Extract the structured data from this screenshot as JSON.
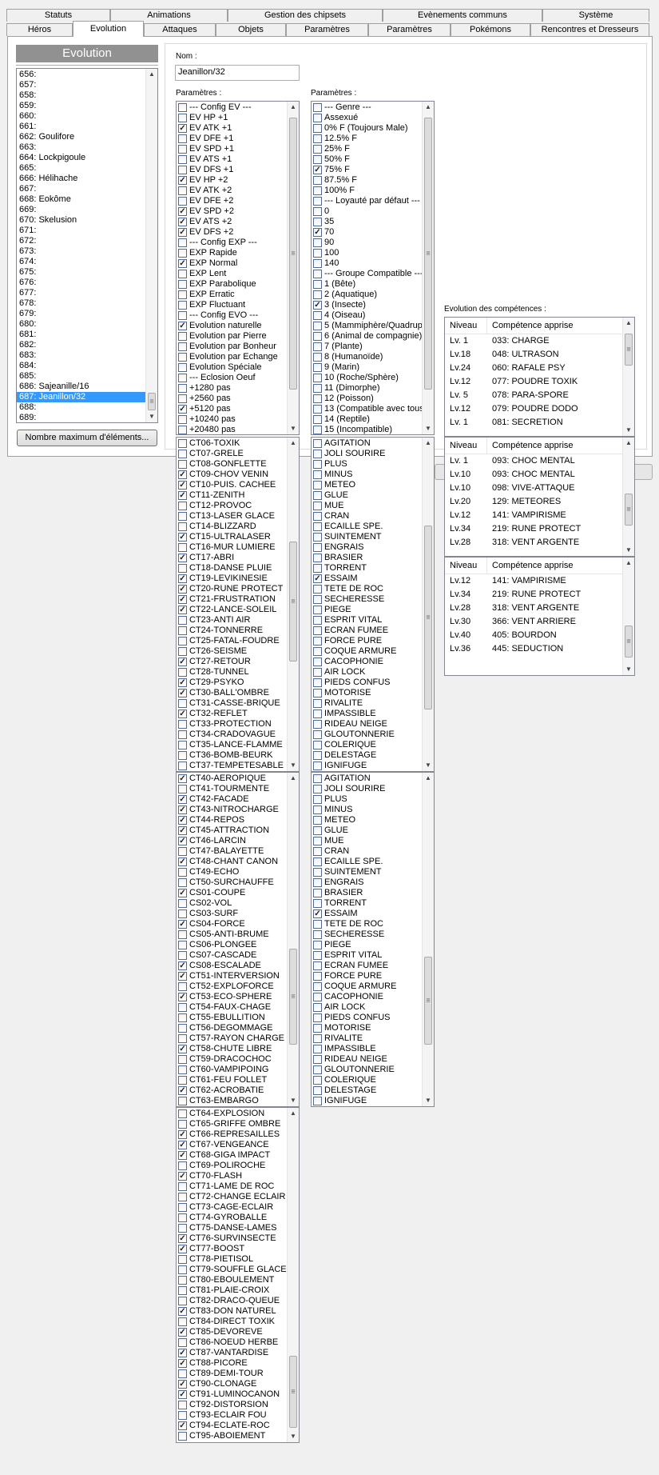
{
  "tabs_row1": [
    "Statuts",
    "Animations",
    "Gestion des chipsets",
    "Evènements communs",
    "Système"
  ],
  "tabs_row2": [
    "Héros",
    "Evolution",
    "Attaques",
    "Objets",
    "Paramètres",
    "Paramètres",
    "Pokémons",
    "Rencontres et Dresseurs"
  ],
  "active_tab": "Evolution",
  "evolution": {
    "title": "Evolution",
    "selected_index": 15,
    "items": [
      "656:",
      "657:",
      "658:",
      "659:",
      "660:",
      "661:",
      "662: Goulifore",
      "663:",
      "664: Lockpigoule",
      "665:",
      "666: Hélihache",
      "667:",
      "668: Eokôme",
      "669:",
      "670: Skelusion",
      "671:",
      "672:",
      "673:",
      "674:",
      "675:",
      "676:",
      "677:",
      "678:",
      "679:",
      "680:",
      "681:",
      "682:",
      "683:",
      "684:",
      "685:",
      "686: Sajeanille/16",
      "687: Jeanillon/32",
      "688:",
      "689:"
    ],
    "max_button": "Nombre maximum d'éléments..."
  },
  "nom": {
    "label": "Nom :",
    "value": "Jeanillon/32"
  },
  "params1": {
    "label": "Paramètres :",
    "items": [
      [
        "--- Config EV ---",
        0
      ],
      [
        "EV HP +1",
        0
      ],
      [
        "EV ATK +1",
        1
      ],
      [
        "EV DFE +1",
        0
      ],
      [
        "EV SPD +1",
        0
      ],
      [
        "EV ATS +1",
        0
      ],
      [
        "EV DFS +1",
        0
      ],
      [
        "EV HP +2",
        1
      ],
      [
        "EV ATK +2",
        0
      ],
      [
        "EV DFE +2",
        0
      ],
      [
        "EV SPD +2",
        1
      ],
      [
        "EV ATS +2",
        1
      ],
      [
        "EV DFS +2",
        1
      ],
      [
        "--- Config EXP ---",
        0
      ],
      [
        "EXP Rapide",
        0
      ],
      [
        "EXP Normal",
        1
      ],
      [
        "EXP Lent",
        0
      ],
      [
        "EXP Parabolique",
        0
      ],
      [
        "EXP Erratic",
        0
      ],
      [
        "EXP Fluctuant",
        0
      ],
      [
        "--- Config EVO ---",
        0
      ],
      [
        "Evolution naturelle",
        1
      ],
      [
        "Evolution par Pierre",
        0
      ],
      [
        "Evolution par Bonheur",
        0
      ],
      [
        "Evolution par Echange",
        0
      ],
      [
        "Evolution Spéciale",
        0
      ],
      [
        "--- Eclosion Oeuf",
        0
      ],
      [
        "+1280 pas",
        0
      ],
      [
        "+2560 pas",
        0
      ],
      [
        "+5120 pas",
        1
      ],
      [
        "+10240 pas",
        0
      ],
      [
        "+20480 pas",
        0
      ]
    ]
  },
  "params2": {
    "label": "Paramètres :",
    "items": [
      [
        "--- Genre ---",
        0
      ],
      [
        "Assexué",
        0
      ],
      [
        "0% F (Toujours Male)",
        0
      ],
      [
        "12.5% F",
        0
      ],
      [
        "25% F",
        0
      ],
      [
        "50% F",
        0
      ],
      [
        "75% F",
        1
      ],
      [
        "87.5% F",
        0
      ],
      [
        "100% F",
        0
      ],
      [
        "--- Loyauté par défaut ---",
        0
      ],
      [
        "0",
        0
      ],
      [
        "35",
        0
      ],
      [
        "70",
        1
      ],
      [
        "90",
        0
      ],
      [
        "100",
        0
      ],
      [
        "140",
        0
      ],
      [
        "--- Groupe Compatible ---",
        0
      ],
      [
        "1 (Bête)",
        0
      ],
      [
        "2 (Aquatique)",
        0
      ],
      [
        "3 (Insecte)",
        1
      ],
      [
        "4 (Oiseau)",
        0
      ],
      [
        "5 (Mammiphère/Quadrup",
        0
      ],
      [
        "6 (Animal de compagnie)",
        0
      ],
      [
        "7 (Plante)",
        0
      ],
      [
        "8 (Humanoïde)",
        0
      ],
      [
        "9 (Marin)",
        0
      ],
      [
        "10 (Roche/Sphère)",
        0
      ],
      [
        "11 (Dimorphe)",
        0
      ],
      [
        "12 (Poisson)",
        0
      ],
      [
        "13 (Compatible avec tous",
        0
      ],
      [
        "14 (Reptile)",
        0
      ],
      [
        "15 (Incompatible)",
        0
      ]
    ]
  },
  "ct1": [
    [
      "CT06-TOXIK",
      0
    ],
    [
      "CT07-GRELE",
      0
    ],
    [
      "CT08-GONFLETTE",
      0
    ],
    [
      "CT09-CHOV VENIN",
      1
    ],
    [
      "CT10-PUIS. CACHEE",
      1
    ],
    [
      "CT11-ZENITH",
      1
    ],
    [
      "CT12-PROVOC",
      0
    ],
    [
      "CT13-LASER GLACE",
      0
    ],
    [
      "CT14-BLIZZARD",
      0
    ],
    [
      "CT15-ULTRALASER",
      1
    ],
    [
      "CT16-MUR LUMIERE",
      0
    ],
    [
      "CT17-ABRI",
      1
    ],
    [
      "CT18-DANSE PLUIE",
      0
    ],
    [
      "CT19-LEVIKINESIE",
      1
    ],
    [
      "CT20-RUNE PROTECT",
      1
    ],
    [
      "CT21-FRUSTRATION",
      1
    ],
    [
      "CT22-LANCE-SOLEIL",
      1
    ],
    [
      "CT23-ANTI AIR",
      0
    ],
    [
      "CT24-TONNERRE",
      0
    ],
    [
      "CT25-FATAL-FOUDRE",
      0
    ],
    [
      "CT26-SEISME",
      0
    ],
    [
      "CT27-RETOUR",
      1
    ],
    [
      "CT28-TUNNEL",
      0
    ],
    [
      "CT29-PSYKO",
      1
    ],
    [
      "CT30-BALL'OMBRE",
      1
    ],
    [
      "CT31-CASSE-BRIQUE",
      0
    ],
    [
      "CT32-REFLET",
      1
    ],
    [
      "CT33-PROTECTION",
      0
    ],
    [
      "CT34-CRADOVAGUE",
      0
    ],
    [
      "CT35-LANCE-FLAMME",
      0
    ],
    [
      "CT36-BOMB-BEURK",
      0
    ],
    [
      "CT37-TEMPETESABLE",
      0
    ]
  ],
  "ab1": [
    [
      "AGITATION",
      0
    ],
    [
      "JOLI SOURIRE",
      0
    ],
    [
      "PLUS",
      0
    ],
    [
      "MINUS",
      0
    ],
    [
      "METEO",
      0
    ],
    [
      "GLUE",
      0
    ],
    [
      "MUE",
      0
    ],
    [
      "CRAN",
      0
    ],
    [
      "ECAILLE SPE.",
      0
    ],
    [
      "SUINTEMENT",
      0
    ],
    [
      "ENGRAIS",
      0
    ],
    [
      "BRASIER",
      0
    ],
    [
      "TORRENT",
      0
    ],
    [
      "ESSAIM",
      1
    ],
    [
      "TETE DE ROC",
      0
    ],
    [
      "SECHERESSE",
      0
    ],
    [
      "PIEGE",
      0
    ],
    [
      "ESPRIT VITAL",
      0
    ],
    [
      "ECRAN FUMEE",
      0
    ],
    [
      "FORCE PURE",
      0
    ],
    [
      "COQUE ARMURE",
      0
    ],
    [
      "CACOPHONIE",
      0
    ],
    [
      "AIR LOCK",
      0
    ],
    [
      "PIEDS CONFUS",
      0
    ],
    [
      "MOTORISE",
      0
    ],
    [
      "RIVALITE",
      0
    ],
    [
      "IMPASSIBLE",
      0
    ],
    [
      "RIDEAU NEIGE",
      0
    ],
    [
      "GLOUTONNERIE",
      0
    ],
    [
      "COLERIQUE",
      0
    ],
    [
      "DELESTAGE",
      0
    ],
    [
      "IGNIFUGE",
      0
    ]
  ],
  "ct2": [
    [
      "CT40-AEROPIQUE",
      1
    ],
    [
      "CT41-TOURMENTE",
      0
    ],
    [
      "CT42-FACADE",
      1
    ],
    [
      "CT43-NITROCHARGE",
      1
    ],
    [
      "CT44-REPOS",
      1
    ],
    [
      "CT45-ATTRACTION",
      1
    ],
    [
      "CT46-LARCIN",
      1
    ],
    [
      "CT47-BALAYETTE",
      0
    ],
    [
      "CT48-CHANT CANON",
      1
    ],
    [
      "CT49-ECHO",
      0
    ],
    [
      "CT50-SURCHAUFFE",
      0
    ],
    [
      "CS01-COUPE",
      1
    ],
    [
      "CS02-VOL",
      0
    ],
    [
      "CS03-SURF",
      0
    ],
    [
      "CS04-FORCE",
      1
    ],
    [
      "CS05-ANTI-BRUME",
      0
    ],
    [
      "CS06-PLONGEE",
      0
    ],
    [
      "CS07-CASCADE",
      0
    ],
    [
      "CS08-ESCALADE",
      1
    ],
    [
      "CT51-INTERVERSION",
      1
    ],
    [
      "CT52-EXPLOFORCE",
      0
    ],
    [
      "CT53-ECO-SPHERE",
      1
    ],
    [
      "CT54-FAUX-CHAGE",
      0
    ],
    [
      "CT55-EBULLITION",
      0
    ],
    [
      "CT56-DEGOMMAGE",
      0
    ],
    [
      "CT57-RAYON CHARGE",
      0
    ],
    [
      "CT58-CHUTE LIBRE",
      1
    ],
    [
      "CT59-DRACOCHOC",
      0
    ],
    [
      "CT60-VAMPIPOING",
      0
    ],
    [
      "CT61-FEU FOLLET",
      0
    ],
    [
      "CT62-ACROBATIE",
      1
    ],
    [
      "CT63-EMBARGO",
      0
    ]
  ],
  "ab2": [
    [
      "AGITATION",
      0
    ],
    [
      "JOLI SOURIRE",
      0
    ],
    [
      "PLUS",
      0
    ],
    [
      "MINUS",
      0
    ],
    [
      "METEO",
      0
    ],
    [
      "GLUE",
      0
    ],
    [
      "MUE",
      0
    ],
    [
      "CRAN",
      0
    ],
    [
      "ECAILLE SPE.",
      0
    ],
    [
      "SUINTEMENT",
      0
    ],
    [
      "ENGRAIS",
      0
    ],
    [
      "BRASIER",
      0
    ],
    [
      "TORRENT",
      0
    ],
    [
      "ESSAIM",
      1
    ],
    [
      "TETE DE ROC",
      0
    ],
    [
      "SECHERESSE",
      0
    ],
    [
      "PIEGE",
      0
    ],
    [
      "ESPRIT VITAL",
      0
    ],
    [
      "ECRAN FUMEE",
      0
    ],
    [
      "FORCE PURE",
      0
    ],
    [
      "COQUE ARMURE",
      0
    ],
    [
      "CACOPHONIE",
      0
    ],
    [
      "AIR LOCK",
      0
    ],
    [
      "PIEDS CONFUS",
      0
    ],
    [
      "MOTORISE",
      0
    ],
    [
      "RIVALITE",
      0
    ],
    [
      "IMPASSIBLE",
      0
    ],
    [
      "RIDEAU NEIGE",
      0
    ],
    [
      "GLOUTONNERIE",
      0
    ],
    [
      "COLERIQUE",
      0
    ],
    [
      "DELESTAGE",
      0
    ],
    [
      "IGNIFUGE",
      0
    ]
  ],
  "ct3": [
    [
      "CT64-EXPLOSION",
      0
    ],
    [
      "CT65-GRIFFE OMBRE",
      0
    ],
    [
      "CT66-REPRESAILLES",
      1
    ],
    [
      "CT67-VENGEANCE",
      1
    ],
    [
      "CT68-GIGA IMPACT",
      1
    ],
    [
      "CT69-POLIROCHE",
      0
    ],
    [
      "CT70-FLASH",
      1
    ],
    [
      "CT71-LAME DE ROC",
      0
    ],
    [
      "CT72-CHANGE ECLAIR",
      0
    ],
    [
      "CT73-CAGE-ECLAIR",
      0
    ],
    [
      "CT74-GYROBALLE",
      0
    ],
    [
      "CT75-DANSE-LAMES",
      0
    ],
    [
      "CT76-SURVINSECTE",
      1
    ],
    [
      "CT77-BOOST",
      1
    ],
    [
      "CT78-PIETISOL",
      0
    ],
    [
      "CT79-SOUFFLE GLACE",
      0
    ],
    [
      "CT80-EBOULEMENT",
      0
    ],
    [
      "CT81-PLAIE-CROIX",
      0
    ],
    [
      "CT82-DRACO-QUEUE",
      0
    ],
    [
      "CT83-DON NATUREL",
      1
    ],
    [
      "CT84-DIRECT TOXIK",
      0
    ],
    [
      "CT85-DEVOREVE",
      1
    ],
    [
      "CT86-NOEUD HERBE",
      0
    ],
    [
      "CT87-VANTARDISE",
      1
    ],
    [
      "CT88-PICORE",
      1
    ],
    [
      "CT89-DEMI-TOUR",
      0
    ],
    [
      "CT90-CLONAGE",
      1
    ],
    [
      "CT91-LUMINOCANON",
      1
    ],
    [
      "CT92-DISTORSION",
      0
    ],
    [
      "CT93-ECLAIR FOU",
      0
    ],
    [
      "CT94-ECLATE-ROC",
      1
    ],
    [
      "CT95-ABOIEMENT",
      0
    ]
  ],
  "evo_comp": {
    "label": "Evolution des compétences :",
    "col_level": "Niveau",
    "col_skill": "Compétence apprise",
    "table1": [
      [
        "Lv. 1",
        "033: CHARGE"
      ],
      [
        "Lv.18",
        "048: ULTRASON"
      ],
      [
        "Lv.24",
        "060: RAFALE PSY"
      ],
      [
        "Lv.12",
        "077: POUDRE TOXIK"
      ],
      [
        "Lv. 5",
        "078: PARA-SPORE"
      ],
      [
        "Lv.12",
        "079: POUDRE DODO"
      ],
      [
        "Lv. 1",
        "081: SECRETION"
      ]
    ],
    "table2": [
      [
        "Lv. 1",
        "093: CHOC MENTAL"
      ],
      [
        "Lv.10",
        "093: CHOC MENTAL"
      ],
      [
        "Lv.10",
        "098: VIVE-ATTAQUE"
      ],
      [
        "Lv.20",
        "129: METEORES"
      ],
      [
        "Lv.12",
        "141: VAMPIRISME"
      ],
      [
        "Lv.34",
        "219: RUNE PROTECT"
      ],
      [
        "Lv.28",
        "318: VENT ARGENTE"
      ]
    ],
    "table3": [
      [
        "Lv.12",
        "141: VAMPIRISME"
      ],
      [
        "Lv.34",
        "219: RUNE PROTECT"
      ],
      [
        "Lv.28",
        "318: VENT ARGENTE"
      ],
      [
        "Lv.30",
        "366: VENT ARRIERE"
      ],
      [
        "Lv.40",
        "405: BOURDON"
      ],
      [
        "Lv.36",
        "445: SEDUCTION"
      ]
    ]
  },
  "icons": {
    "scroll_up": "scroll-up-arrow",
    "scroll_down": "scroll-down-arrow",
    "check": "checkmark"
  }
}
